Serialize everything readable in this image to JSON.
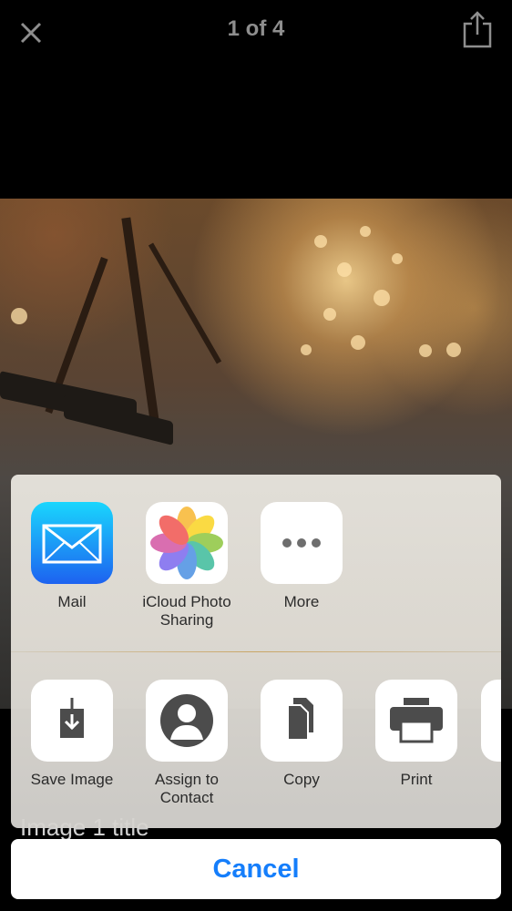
{
  "header": {
    "page_counter": "1 of 4",
    "close_icon": "close-icon",
    "share_icon": "share-icon"
  },
  "photo": {
    "title": "Image 1 title"
  },
  "share_sheet": {
    "apps": [
      {
        "label": "Mail",
        "icon": "mail-icon"
      },
      {
        "label": "iCloud Photo Sharing",
        "icon": "photos-icon"
      },
      {
        "label": "More",
        "icon": "more-icon"
      }
    ],
    "actions": [
      {
        "label": "Save Image",
        "icon": "save-image-icon"
      },
      {
        "label": "Assign to Contact",
        "icon": "contact-icon"
      },
      {
        "label": "Copy",
        "icon": "copy-icon"
      },
      {
        "label": "Print",
        "icon": "print-icon"
      }
    ]
  },
  "cancel_label": "Cancel",
  "colors": {
    "accent": "#157efb",
    "mail_gradient_top": "#1ad6fd",
    "mail_gradient_bottom": "#1d62f0",
    "icon_gray": "#4c4c4c"
  }
}
